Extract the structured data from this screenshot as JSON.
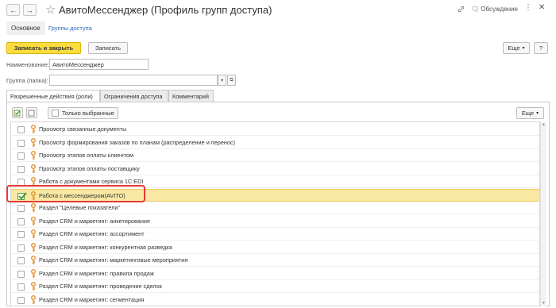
{
  "window": {
    "title": "АвитоМессенджер (Профиль групп доступа)",
    "discussion_label": "Обсуждение",
    "top_icons": [
      "link-icon",
      "discussion-icon",
      "more-icon",
      "close-icon"
    ]
  },
  "nav_tabs": [
    {
      "label": "Основное",
      "active": true
    },
    {
      "label": "Группы доступа",
      "active": false
    }
  ],
  "toolbar": {
    "save_close_label": "Записать и закрыть",
    "save_label": "Записать",
    "more_label": "Еще"
  },
  "form": {
    "name_label": "Наименование:",
    "name_value": "АвитоМессенджер",
    "group_label": "Группа (папка):",
    "group_value": ""
  },
  "panel_tabs": [
    {
      "label": "Разрешенные действия (роли)",
      "active": true
    },
    {
      "label": "Ограничения доступа",
      "active": false
    },
    {
      "label": "Комментарий",
      "active": false
    }
  ],
  "roles_toolbar": {
    "only_selected_label": "Только выбранные",
    "more_label": "Еще"
  },
  "roles": [
    {
      "label": "Просмотр связанные документы",
      "checked": false,
      "selected": false
    },
    {
      "label": "Просмотр формирования заказов по планам (распределение и перенос)",
      "checked": false,
      "selected": false
    },
    {
      "label": "Просмотр этапов оплаты клиентом",
      "checked": false,
      "selected": false
    },
    {
      "label": "Просмотр этапов оплаты поставщику",
      "checked": false,
      "selected": false
    },
    {
      "label": "Работа с документами сервиса 1С:EDI",
      "checked": false,
      "selected": false
    },
    {
      "label": "Работа с мессенджером(AVITO)",
      "checked": true,
      "selected": true
    },
    {
      "label": "Раздел \"Целевые показатели\"",
      "checked": false,
      "selected": false
    },
    {
      "label": "Раздел CRM и маркетинг: анкетирование",
      "checked": false,
      "selected": false
    },
    {
      "label": "Раздел CRM и маркетинг: ассортимент",
      "checked": false,
      "selected": false
    },
    {
      "label": "Раздел CRM и маркетинг: конкурентная разведка",
      "checked": false,
      "selected": false
    },
    {
      "label": "Раздел CRM и маркетинг: маркетинговые мероприятия",
      "checked": false,
      "selected": false
    },
    {
      "label": "Раздел CRM и маркетинг: правила продаж",
      "checked": false,
      "selected": false
    },
    {
      "label": "Раздел CRM и маркетинг: проведение сделок",
      "checked": false,
      "selected": false
    },
    {
      "label": "Раздел CRM и маркетинг: сегментация",
      "checked": false,
      "selected": false
    }
  ],
  "colors": {
    "primary_button": "#fbdc3f",
    "selected_row": "#f9e8a4",
    "highlight_box": "#e53935",
    "key_icon": "#e8902a",
    "checkmark": "#3a8f2a",
    "link": "#2a6ab8"
  }
}
